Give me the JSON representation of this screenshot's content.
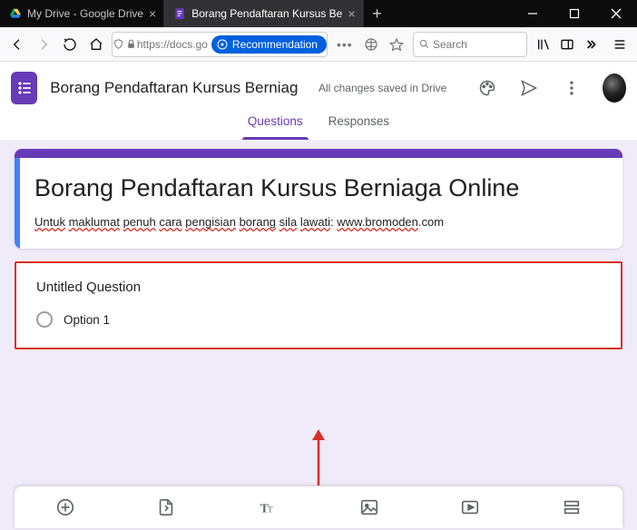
{
  "browser": {
    "tabs": [
      {
        "title": "My Drive - Google Drive",
        "active": false
      },
      {
        "title": "Borang Pendaftaran Kursus Be",
        "active": true
      }
    ],
    "url": "https://docs.go",
    "recommendation_label": "Recommendation",
    "search_placeholder": "Search"
  },
  "header": {
    "document_title": "Borang Pendaftaran Kursus Berniaga Online",
    "save_status": "All changes saved in Drive"
  },
  "form_editor": {
    "tabs": {
      "questions": "Questions",
      "responses": "Responses",
      "active": "questions"
    },
    "title": "Borang Pendaftaran Kursus Berniaga Online",
    "description_parts": {
      "p1": "Untuk",
      "p2": "maklumat",
      "p3": "penuh",
      "p4": "cara",
      "p5": "pengisian",
      "p6": "borang",
      "p7": "sila",
      "p8": "lawati",
      "colon": ": ",
      "domain_err": "www.bromoden",
      "domain_ok": ".com"
    },
    "question": {
      "title": "Untitled Question",
      "option1": "Option 1"
    }
  },
  "colors": {
    "accent": "#673ab7",
    "error": "#d93025",
    "blue": "#4285f4"
  }
}
